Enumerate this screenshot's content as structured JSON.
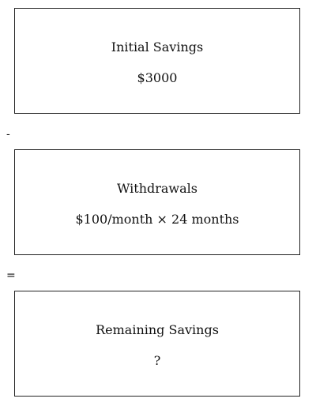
{
  "blocks": [
    {
      "title": "Initial Savings",
      "value": "$3000"
    },
    {
      "title": "Withdrawals",
      "value": "$100/month × 24 months"
    },
    {
      "title": "Remaining Savings",
      "value": "?"
    }
  ],
  "operators": {
    "minus": "-",
    "equals": "="
  }
}
